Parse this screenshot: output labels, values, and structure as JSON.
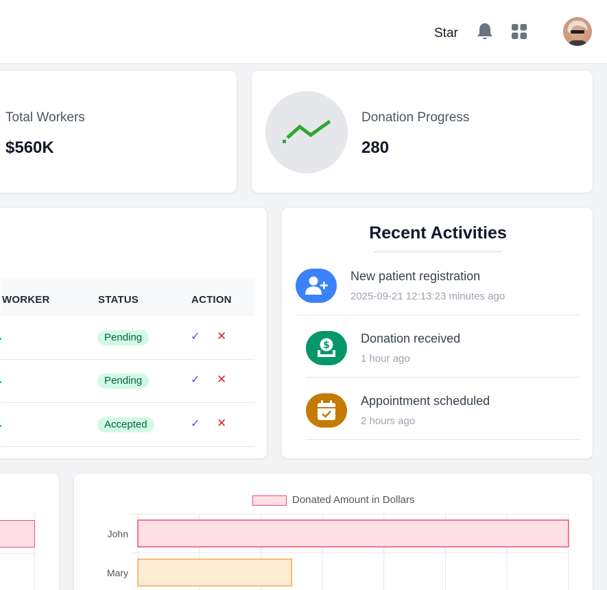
{
  "header": {
    "user_name": "Star",
    "icons": [
      "bell-icon",
      "apps-grid-icon"
    ]
  },
  "stats": [
    {
      "label": "Total Workers",
      "value": "$560K"
    },
    {
      "label": "Donation Progress",
      "value": "280",
      "icon": "trend-up-icon",
      "icon_color": "#2ea82e"
    }
  ],
  "table": {
    "columns": [
      "WORKER",
      "STATUS",
      "ACTION"
    ],
    "rows": [
      {
        "status": "Pending"
      },
      {
        "status": "Pending"
      },
      {
        "status": "Accepted"
      }
    ],
    "approve_symbol": "✓",
    "reject_symbol": "✕"
  },
  "activities": {
    "title": "Recent Activities",
    "items": [
      {
        "text": "New patient registration",
        "time": "2025-09-21 12:13:23 minutes ago",
        "icon": "user-plus-icon",
        "color": "#3b82f6"
      },
      {
        "text": "Donation received",
        "time": "1 hour ago",
        "icon": "donation-icon",
        "color": "#059669"
      },
      {
        "text": "Appointment scheduled",
        "time": "2 hours ago",
        "icon": "calendar-check-icon",
        "color": "#c47b06"
      }
    ]
  },
  "chart_data": {
    "type": "bar",
    "orientation": "horizontal",
    "categories": [
      "John",
      "Mary"
    ],
    "series": [
      {
        "name": "Donated Amount in Dollars",
        "values": [
          7,
          2.5
        ]
      }
    ],
    "colors": [
      "#ffe0e6",
      "#ffecd5"
    ],
    "border_colors": [
      "#ef4d6e",
      "#f5a846"
    ],
    "grid": true,
    "legend_position": "top"
  }
}
